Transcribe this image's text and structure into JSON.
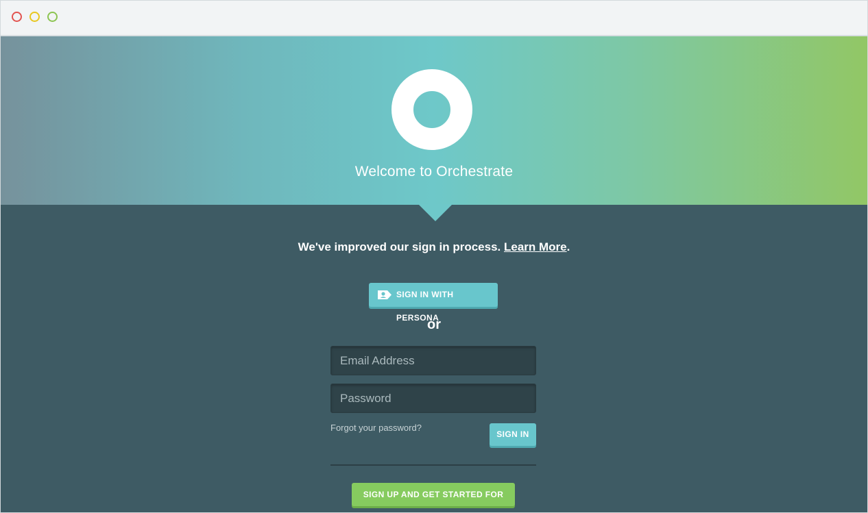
{
  "window": {
    "controls": [
      "close",
      "minimize",
      "maximize"
    ]
  },
  "hero": {
    "logo": "ring-logo",
    "welcome_text": "Welcome to Orchestrate"
  },
  "notice": {
    "text": "We've improved our sign in process.",
    "link_label": "Learn More",
    "suffix": "."
  },
  "persona": {
    "icon": "persona-id-icon",
    "label": "SIGN IN WITH PERSONA"
  },
  "separator": "or",
  "form": {
    "email_placeholder": "Email Address",
    "password_placeholder": "Password",
    "forgot_label": "Forgot your password?",
    "signin_label": "SIGN IN"
  },
  "signup": {
    "label": "SIGN UP AND GET STARTED FOR FREE"
  },
  "colors": {
    "accent_teal": "#68c6cc",
    "accent_green": "#86cb5f",
    "background_dark": "#3e5b64"
  }
}
